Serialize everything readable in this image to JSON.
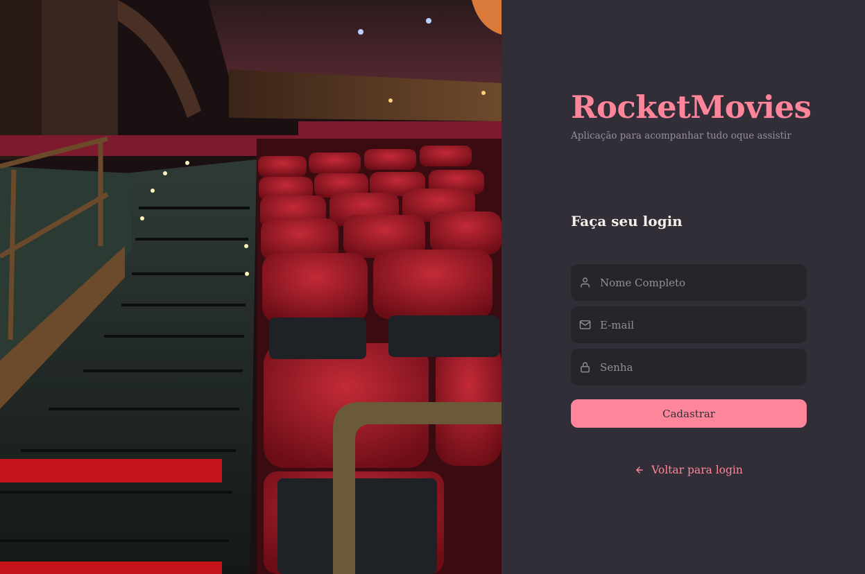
{
  "colors": {
    "background": "#312E38",
    "accent": "#FF859B",
    "input_bg": "#262529",
    "muted_text": "#948F99",
    "heading_text": "#F4EDE8"
  },
  "hero": {
    "icon": "theater-seats-photo"
  },
  "brand": {
    "title": "RocketMovies",
    "subtitle": "Aplicação para acompanhar tudo oque assistir"
  },
  "form": {
    "heading": "Faça seu login",
    "fields": [
      {
        "icon": "user-icon",
        "placeholder": "Nome Completo",
        "value": ""
      },
      {
        "icon": "mail-icon",
        "placeholder": "E-mail",
        "value": ""
      },
      {
        "icon": "lock-icon",
        "placeholder": "Senha",
        "value": ""
      }
    ],
    "submit_label": "Cadastrar"
  },
  "back_link": {
    "icon": "arrow-left-icon",
    "label": "Voltar para login"
  }
}
